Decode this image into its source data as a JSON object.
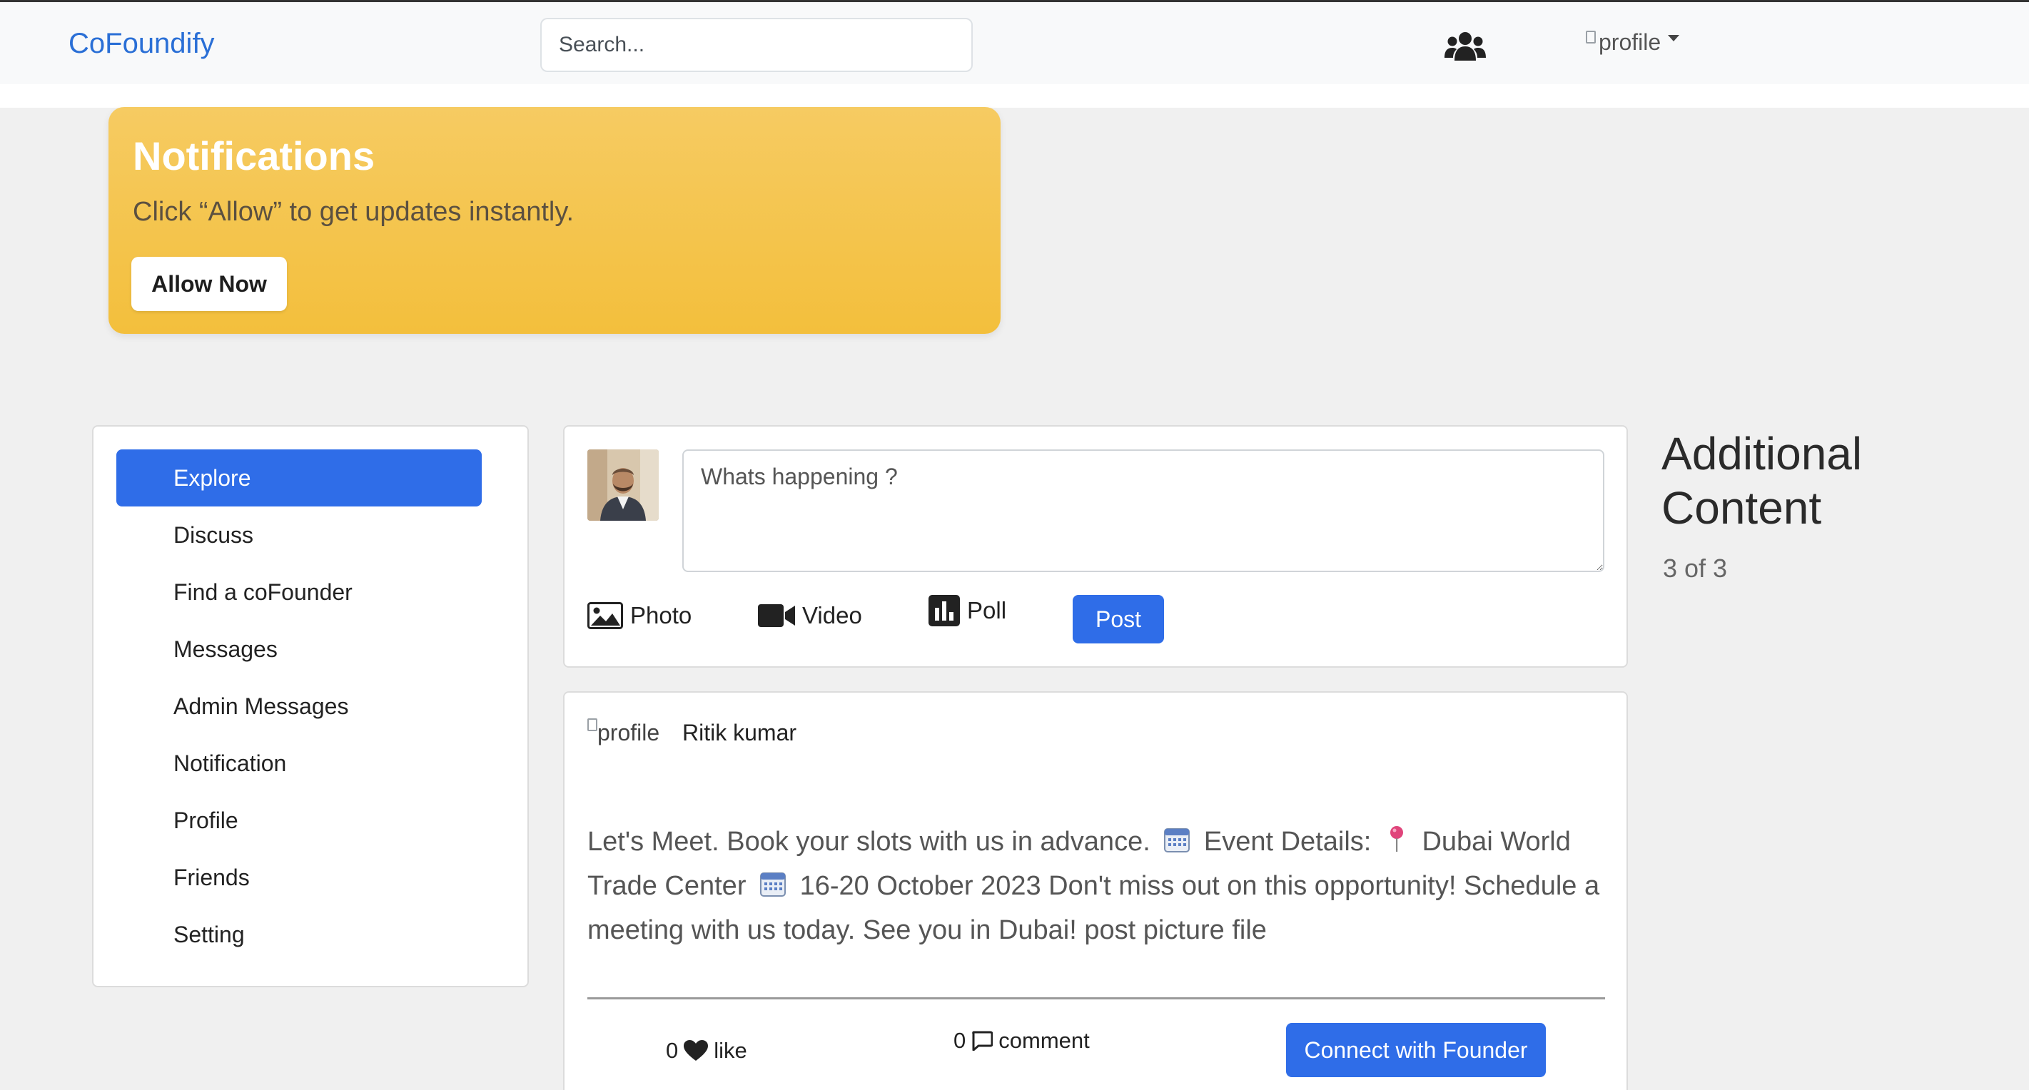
{
  "navbar": {
    "brand": "CoFoundify",
    "search_placeholder": "Search...",
    "users_icon": "users-icon",
    "profile_alt": "profile"
  },
  "notification_banner": {
    "title": "Notifications",
    "text": "Click “Allow” to get updates instantly.",
    "button_label": "Allow Now",
    "color": "#f4c24a"
  },
  "sidebar": {
    "active_color": "#2f6de8",
    "items": [
      {
        "label": "Explore",
        "active": true
      },
      {
        "label": "Discuss",
        "active": false
      },
      {
        "label": "Find a coFounder",
        "active": false
      },
      {
        "label": "Messages",
        "active": false
      },
      {
        "label": "Admin Messages",
        "active": false
      },
      {
        "label": "Notification",
        "active": false
      },
      {
        "label": "Profile",
        "active": false
      },
      {
        "label": "Friends",
        "active": false
      },
      {
        "label": "Setting",
        "active": false
      }
    ]
  },
  "composer": {
    "placeholder": "Whats happening ?",
    "actions": {
      "photo": "Photo",
      "video": "Video",
      "poll": "Poll"
    },
    "post_label": "Post"
  },
  "post": {
    "avatar_alt": "profile",
    "author": "Ritik kumar",
    "body_parts": {
      "p1": "Let's Meet. Book your slots with us in advance.",
      "p2": "Event Details:",
      "p3": "Dubai World Trade Center",
      "p4": "16-20 October 2023 Don't miss out on this opportunity! Schedule a meeting with us today. See you in Dubai! post picture file"
    },
    "likes_count": "0",
    "like_label": "like",
    "comments_count": "0",
    "comment_label": "comment",
    "connect_label": "Connect with Founder"
  },
  "aside": {
    "title": "Additional Content",
    "subtitle": "3 of 3"
  }
}
